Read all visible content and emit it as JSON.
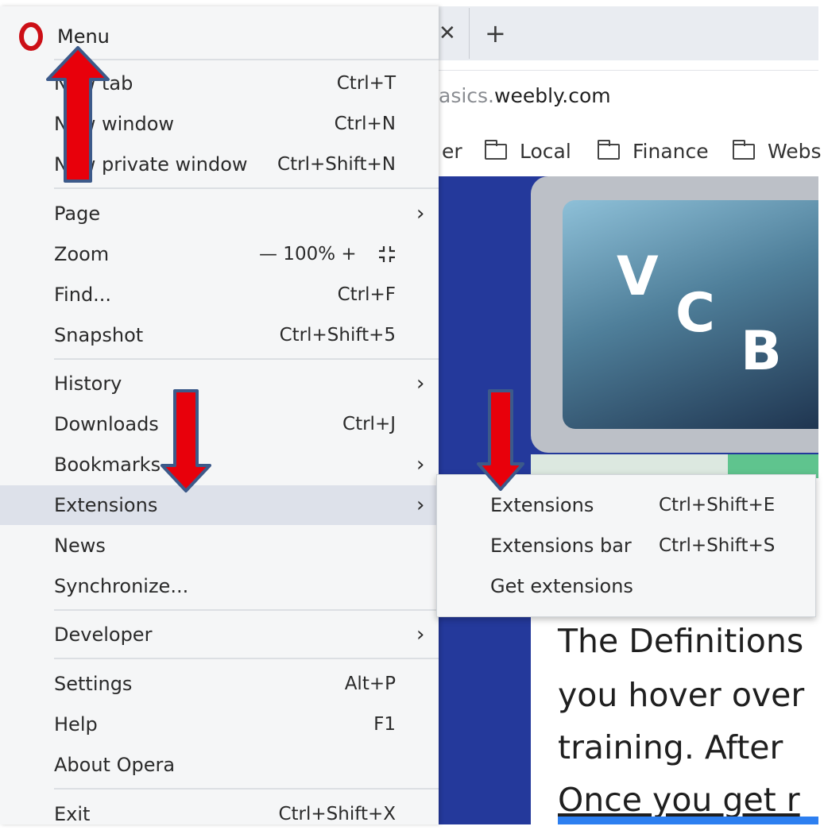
{
  "browser": {
    "tab_close_glyph": "✕",
    "new_tab_glyph": "+",
    "url_prefix": "asics.",
    "url_host": "weebly.com",
    "bookmarks": [
      {
        "label": "er"
      },
      {
        "label": "Local"
      },
      {
        "label": "Finance"
      },
      {
        "label": "Webs"
      }
    ]
  },
  "page": {
    "logo_letters": [
      "V",
      "C",
      "B"
    ],
    "paragraph_lines": [
      "The Definitions",
      "you hover over",
      "training.  After",
      "Once you get r"
    ]
  },
  "menu": {
    "title": "Menu",
    "items": [
      {
        "label": "New tab",
        "shortcut": "Ctrl+T"
      },
      {
        "label": "New window",
        "shortcut": "Ctrl+N"
      },
      {
        "label": "New private window",
        "shortcut": "Ctrl+Shift+N"
      },
      {
        "label": "Page",
        "shortcut": "",
        "submenu": true
      },
      {
        "label": "Zoom",
        "zoom": "— 100% +"
      },
      {
        "label": "Find...",
        "shortcut": "Ctrl+F"
      },
      {
        "label": "Snapshot",
        "shortcut": "Ctrl+Shift+5"
      },
      {
        "label": "History",
        "submenu": true
      },
      {
        "label": "Downloads",
        "shortcut": "Ctrl+J"
      },
      {
        "label": "Bookmarks",
        "submenu": true
      },
      {
        "label": "Extensions",
        "submenu": true,
        "highlighted": true
      },
      {
        "label": "News"
      },
      {
        "label": "Synchronize..."
      },
      {
        "label": "Developer",
        "submenu": true
      },
      {
        "label": "Settings",
        "shortcut": "Alt+P"
      },
      {
        "label": "Help",
        "shortcut": "F1"
      },
      {
        "label": "About Opera"
      },
      {
        "label": "Exit",
        "shortcut": "Ctrl+Shift+X"
      }
    ],
    "chevron": "›"
  },
  "submenu": {
    "items": [
      {
        "label": "Extensions",
        "shortcut": "Ctrl+Shift+E"
      },
      {
        "label": "Extensions bar",
        "shortcut": "Ctrl+Shift+S"
      },
      {
        "label": "Get extensions",
        "shortcut": ""
      }
    ]
  },
  "colors": {
    "opera_red": "#cc0f16",
    "annotation_arrow": "#e8000b",
    "arrow_outline": "#3c5a8a",
    "highlight": "#dde1ea",
    "page_blue": "#24399b"
  },
  "icons": {
    "opera": "opera-logo-icon",
    "fullscreen": "fullscreen-icon",
    "folder": "folder-icon",
    "close": "close-icon",
    "plus": "plus-icon"
  }
}
